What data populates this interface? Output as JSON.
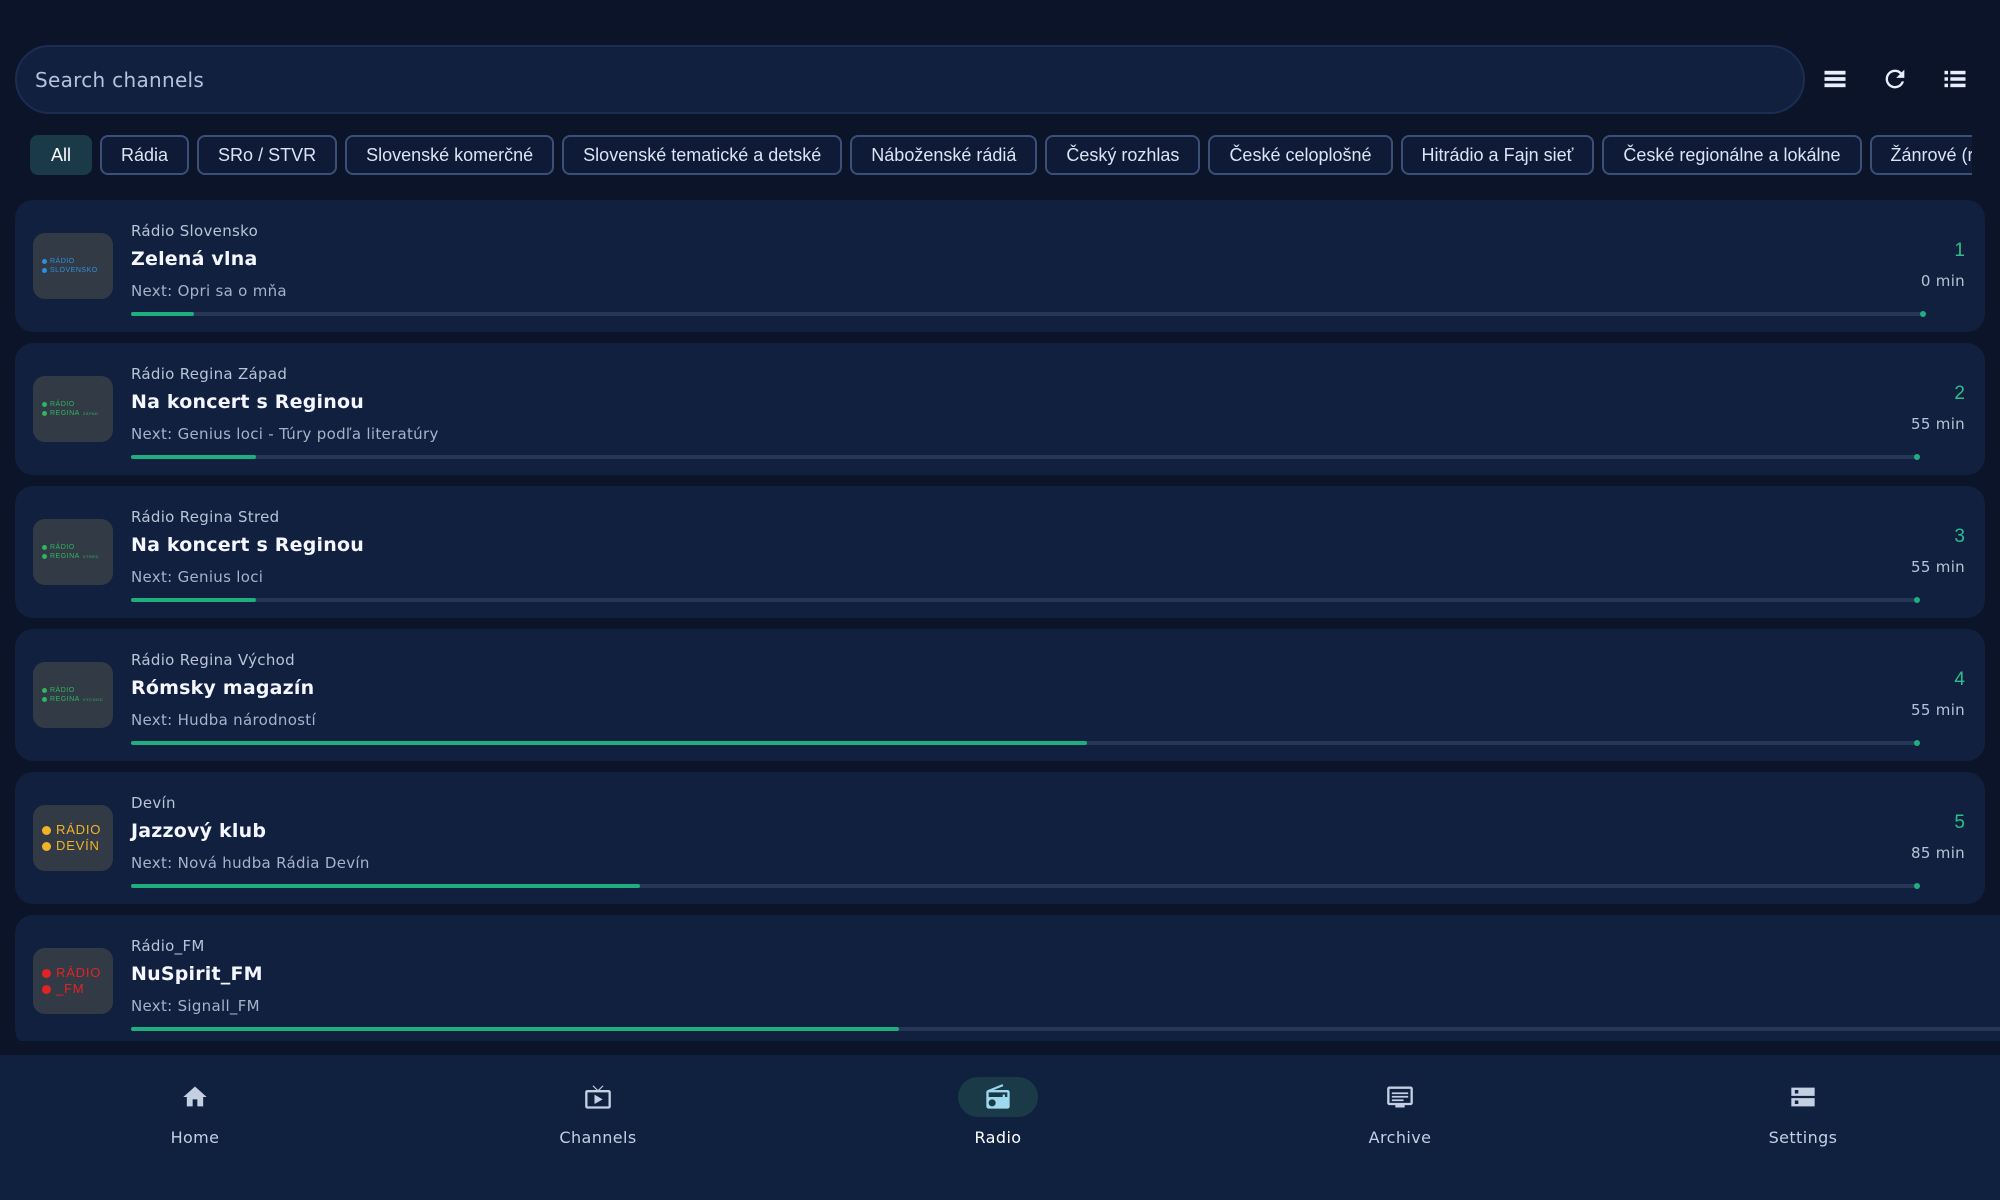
{
  "search": {
    "placeholder": "Search channels"
  },
  "toolbar": {
    "icons": [
      "view-compact-icon",
      "refresh-icon",
      "list-view-icon"
    ]
  },
  "filters": [
    {
      "label": "All",
      "active": true
    },
    {
      "label": "Rádia"
    },
    {
      "label": "SRo / STVR"
    },
    {
      "label": "Slovenské komerčné"
    },
    {
      "label": "Slovenské tematické a detské"
    },
    {
      "label": "Náboženské rádiá"
    },
    {
      "label": "Český rozhlas"
    },
    {
      "label": "České celoplošné"
    },
    {
      "label": "Hitrádio a Fajn sieť"
    },
    {
      "label": "České regionálne a lokálne"
    },
    {
      "label": "Žánrové (rock, dance"
    }
  ],
  "channels": [
    {
      "station": "Rádio Slovensko",
      "show": "Zelená vlna",
      "next": "Next: Opri sa o mňa",
      "number": "1",
      "duration": "0 min",
      "progress": 0.035,
      "logo": {
        "line1": "RÁDIO",
        "line2": "SLOVENSKO",
        "suffix": "",
        "color": "#2f8fd8",
        "size": "small"
      }
    },
    {
      "station": "Rádio Regina Západ",
      "show": "Na koncert s Reginou",
      "next": "Next: Genius loci - Túry podľa literatúry",
      "number": "2",
      "duration": "55 min",
      "progress": 0.07,
      "logo": {
        "line1": "RÁDIO",
        "line2": "REGINA",
        "suffix": "ZÁPAD",
        "color": "#2fb560",
        "size": "small"
      }
    },
    {
      "station": "Rádio Regina Stred",
      "show": "Na koncert s Reginou",
      "next": "Next: Genius loci",
      "number": "3",
      "duration": "55 min",
      "progress": 0.07,
      "logo": {
        "line1": "RÁDIO",
        "line2": "REGINA",
        "suffix": "STRED",
        "color": "#2fb560",
        "size": "small"
      }
    },
    {
      "station": "Rádio Regina Východ",
      "show": "Rómsky magazín",
      "next": "Next: Hudba národností",
      "number": "4",
      "duration": "55 min",
      "progress": 0.535,
      "logo": {
        "line1": "RÁDIO",
        "line2": "REGINA",
        "suffix": "VÝCHOD",
        "color": "#2fb560",
        "size": "small"
      }
    },
    {
      "station": "Devín",
      "show": "Jazzový klub",
      "next": "Next: Nová hudba Rádia Devín",
      "number": "5",
      "duration": "85 min",
      "progress": 0.285,
      "logo": {
        "line1": "RÁDIO",
        "line2": "DEVÍN",
        "suffix": "",
        "color": "#f0b429",
        "size": "big"
      }
    },
    {
      "station": "Rádio_FM",
      "show": "NuSpirit_FM",
      "next": "Next: Signall_FM",
      "number": "",
      "duration": "",
      "progress": 0.41,
      "logo": {
        "line1": "RÁDIO",
        "line2": "_FM",
        "suffix": "",
        "color": "#e02424",
        "size": "big"
      }
    }
  ],
  "nav": [
    {
      "label": "Home",
      "icon": "home-icon",
      "active": false
    },
    {
      "label": "Channels",
      "icon": "tv-icon",
      "active": false
    },
    {
      "label": "Radio",
      "icon": "radio-icon",
      "active": true
    },
    {
      "label": "Archive",
      "icon": "archive-icon",
      "active": false
    },
    {
      "label": "Settings",
      "icon": "settings-icon",
      "active": false
    }
  ],
  "colors": {
    "accent": "#1fae7e",
    "number": "#2bbf8a",
    "card": "#12203f",
    "background": "#0b1429",
    "nav_background": "#10203f"
  }
}
